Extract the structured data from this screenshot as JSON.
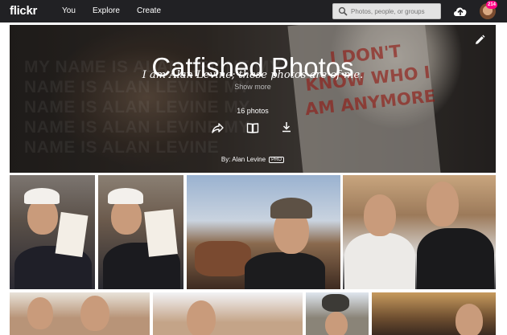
{
  "nav": {
    "logo": "flickr",
    "links": [
      "You",
      "Explore",
      "Create"
    ],
    "search_placeholder": "Photos, people, or groups",
    "notification_count": "214"
  },
  "album": {
    "title": "Catfished Photos",
    "description": "I am Alan Levine; these photos are of me.",
    "show_more": "Show more",
    "photo_count": "16 photos",
    "byline_prefix": "By: Alan Levine",
    "pro_badge": "PRO",
    "background_text": "MY NAME IS ALAN LEVINE MY NAME IS ALAN LEVINE MY NAME IS ALAN LEVINE MY NAME IS ALAN LEVINE MY NAME IS ALAN LEVINE",
    "sign_text": "I DON'T KNOW WHO I AM ANYMORE"
  },
  "photos": [
    {
      "name": "photo-man-red-cap-holding-sign"
    },
    {
      "name": "photo-man-red-cap-holding-drawing"
    },
    {
      "name": "photo-man-beanie-horses"
    },
    {
      "name": "photo-two-men-lanyards"
    },
    {
      "name": "photo-boy-and-man"
    },
    {
      "name": "photo-man-bright-background"
    },
    {
      "name": "photo-man-holding-object"
    },
    {
      "name": "photo-man-street"
    }
  ],
  "colors": {
    "nav_bg": "#212124",
    "badge": "#ff0084"
  }
}
